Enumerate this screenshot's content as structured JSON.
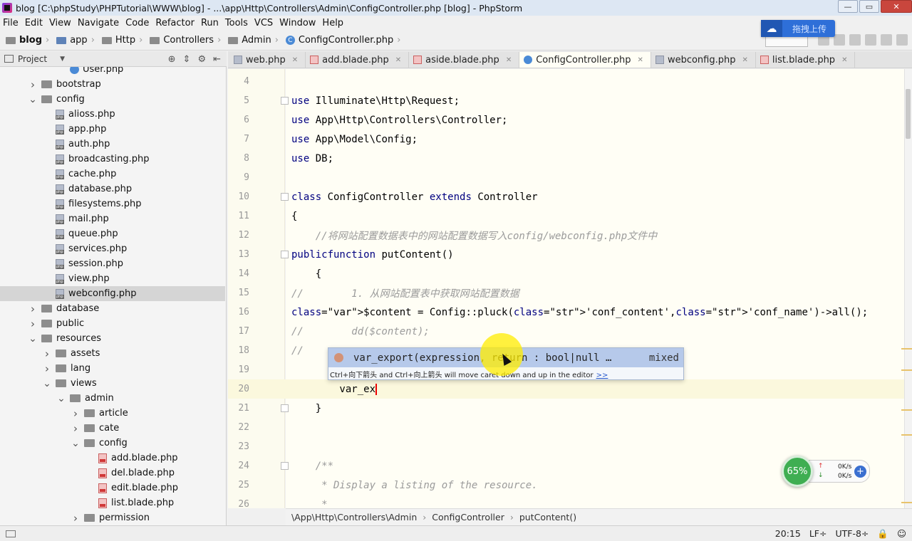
{
  "window": {
    "title": "blog [C:\\phpStudy\\PHPTutorial\\WWW\\blog] - ...\\app\\Http\\Controllers\\Admin\\ConfigController.php [blog] - PhpStorm",
    "minimize": "—",
    "maximize": "▭",
    "close": "✕"
  },
  "menu": [
    "File",
    "Edit",
    "View",
    "Navigate",
    "Code",
    "Refactor",
    "Run",
    "Tools",
    "VCS",
    "Window",
    "Help"
  ],
  "nav": {
    "crumbs": [
      "blog",
      "app",
      "Http",
      "Controllers",
      "Admin",
      "ConfigController.php"
    ]
  },
  "upload_chip": {
    "label": "拖拽上传"
  },
  "project": {
    "label": "Project",
    "tree": [
      {
        "label": "User.php",
        "indent": 3,
        "icon": "class",
        "twisty": ""
      },
      {
        "label": "bootstrap",
        "indent": 1,
        "icon": "folder",
        "twisty": "right"
      },
      {
        "label": "config",
        "indent": 1,
        "icon": "folder",
        "twisty": "down"
      },
      {
        "label": "alioss.php",
        "indent": 2,
        "icon": "php",
        "twisty": ""
      },
      {
        "label": "app.php",
        "indent": 2,
        "icon": "php",
        "twisty": ""
      },
      {
        "label": "auth.php",
        "indent": 2,
        "icon": "php",
        "twisty": ""
      },
      {
        "label": "broadcasting.php",
        "indent": 2,
        "icon": "php",
        "twisty": ""
      },
      {
        "label": "cache.php",
        "indent": 2,
        "icon": "php",
        "twisty": ""
      },
      {
        "label": "database.php",
        "indent": 2,
        "icon": "php",
        "twisty": ""
      },
      {
        "label": "filesystems.php",
        "indent": 2,
        "icon": "php",
        "twisty": ""
      },
      {
        "label": "mail.php",
        "indent": 2,
        "icon": "php",
        "twisty": ""
      },
      {
        "label": "queue.php",
        "indent": 2,
        "icon": "php",
        "twisty": ""
      },
      {
        "label": "services.php",
        "indent": 2,
        "icon": "php",
        "twisty": ""
      },
      {
        "label": "session.php",
        "indent": 2,
        "icon": "php",
        "twisty": ""
      },
      {
        "label": "view.php",
        "indent": 2,
        "icon": "php",
        "twisty": ""
      },
      {
        "label": "webconfig.php",
        "indent": 2,
        "icon": "php",
        "twisty": "",
        "selected": true
      },
      {
        "label": "database",
        "indent": 1,
        "icon": "folder",
        "twisty": "right"
      },
      {
        "label": "public",
        "indent": 1,
        "icon": "folder",
        "twisty": "right"
      },
      {
        "label": "resources",
        "indent": 1,
        "icon": "folder",
        "twisty": "down"
      },
      {
        "label": "assets",
        "indent": 2,
        "icon": "folder",
        "twisty": "right"
      },
      {
        "label": "lang",
        "indent": 2,
        "icon": "folder",
        "twisty": "right"
      },
      {
        "label": "views",
        "indent": 2,
        "icon": "folder",
        "twisty": "down"
      },
      {
        "label": "admin",
        "indent": 3,
        "icon": "folder",
        "twisty": "down"
      },
      {
        "label": "article",
        "indent": 4,
        "icon": "folder",
        "twisty": "right"
      },
      {
        "label": "cate",
        "indent": 4,
        "icon": "folder",
        "twisty": "right"
      },
      {
        "label": "config",
        "indent": 4,
        "icon": "folder",
        "twisty": "down"
      },
      {
        "label": "add.blade.php",
        "indent": 5,
        "icon": "blade",
        "twisty": ""
      },
      {
        "label": "del.blade.php",
        "indent": 5,
        "icon": "blade",
        "twisty": ""
      },
      {
        "label": "edit.blade.php",
        "indent": 5,
        "icon": "blade",
        "twisty": ""
      },
      {
        "label": "list.blade.php",
        "indent": 5,
        "icon": "blade",
        "twisty": ""
      },
      {
        "label": "permission",
        "indent": 4,
        "icon": "folder",
        "twisty": "right"
      }
    ]
  },
  "tabs": [
    {
      "label": "web.php",
      "icon": "php",
      "active": false
    },
    {
      "label": "add.blade.php",
      "icon": "blade",
      "active": false
    },
    {
      "label": "aside.blade.php",
      "icon": "blade",
      "active": false
    },
    {
      "label": "ConfigController.php",
      "icon": "class",
      "active": true
    },
    {
      "label": "webconfig.php",
      "icon": "php",
      "active": false
    },
    {
      "label": "list.blade.php",
      "icon": "blade",
      "active": false
    }
  ],
  "editor": {
    "line_numbers": [
      "4",
      "5",
      "6",
      "7",
      "8",
      "9",
      "10",
      "11",
      "12",
      "13",
      "14",
      "15",
      "16",
      "17",
      "18",
      "19",
      "20",
      "21",
      "22",
      "23",
      "24",
      "25",
      "26"
    ],
    "lines": [
      "",
      "use Illuminate\\Http\\Request;",
      "use App\\Http\\Controllers\\Controller;",
      "use App\\Model\\Config;",
      "use DB;",
      "",
      "class ConfigController extends Controller",
      "{",
      "    //将网站配置数据表中的网站配置数据写入config/webconfig.php文件中",
      "    public function putContent()",
      "    {",
      "//        1. 从网站配置表中获取网站配置数据",
      "        $content = Config::pluck('conf_content','conf_name')->all();",
      "//        dd($content);",
      "//",
      "",
      "        var_ex",
      "    }",
      "",
      "",
      "    /**",
      "     * Display a listing of the resource.",
      "     *"
    ]
  },
  "completion": {
    "item": "var_export(expression, return : bool|null …",
    "type": "mixed",
    "hint": "Ctrl+向下箭头 and Ctrl+向上箭头 will move caret down and up in the editor",
    "more": ">>"
  },
  "editor_crumbs": [
    "\\App\\Http\\Controllers\\Admin",
    "ConfigController",
    "putContent()"
  ],
  "status": {
    "position": "20:15",
    "line_sep": "LF÷",
    "encoding": "UTF-8÷"
  },
  "speed": {
    "percent": "65%",
    "up": "0K/s",
    "down": "0K/s"
  }
}
